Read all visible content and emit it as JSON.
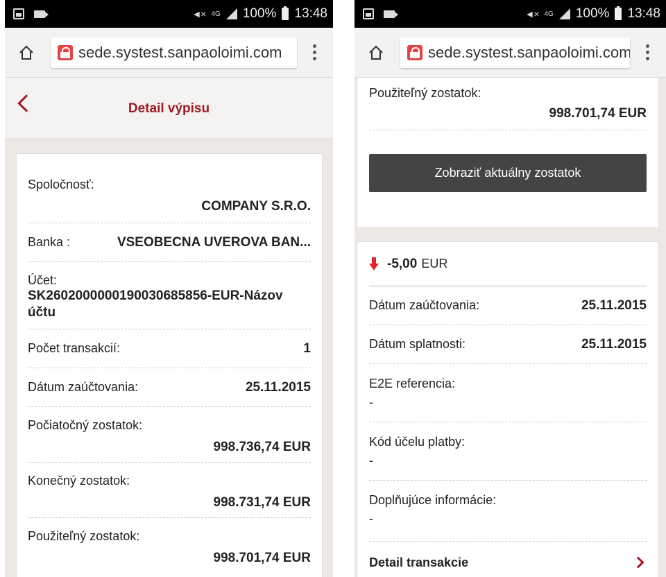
{
  "status_bar": {
    "network": "4G",
    "battery": "100%",
    "time": "13:48"
  },
  "browser": {
    "url": "sede.systest.sanpaoloimi.com"
  },
  "left_screen": {
    "title": "Detail výpisu",
    "fields": [
      {
        "label": "Spoločnosť:",
        "value": "COMPANY S.R.O."
      },
      {
        "label": "Banka :",
        "value": "VSEOBECNA UVEROVA BAN..."
      },
      {
        "label": "Účet:",
        "value": "SK2602000000190030685856-EUR-Názov účtu"
      },
      {
        "label": "Počet transakcií:",
        "value": "1"
      },
      {
        "label": "Dátum zaúčtovania:",
        "value": "25.11.2015"
      },
      {
        "label": "Počiatočný zostatok:",
        "value": "998.736,74 EUR"
      },
      {
        "label": "Konečný zostatok:",
        "value": "998.731,74 EUR"
      },
      {
        "label": "Použiteľný zostatok:",
        "value": "998.701,74 EUR"
      }
    ]
  },
  "right_screen": {
    "available_balance": {
      "label": "Použiteľný zostatok:",
      "value": "998.701,74 EUR"
    },
    "show_balance_button": "Zobraziť aktuálny zostatok",
    "transaction": {
      "amount": "-5,00",
      "currency": "EUR",
      "fields": [
        {
          "label": "Dátum zaúčtovania:",
          "value": "25.11.2015"
        },
        {
          "label": "Dátum splatnosti:",
          "value": "25.11.2015"
        },
        {
          "label": "E2E referencia:",
          "value": "-"
        },
        {
          "label": "Kód účelu platby:",
          "value": "-"
        },
        {
          "label": "Doplňujúce informácie:",
          "value": "-"
        }
      ],
      "detail_link": "Detail transakcie"
    }
  }
}
